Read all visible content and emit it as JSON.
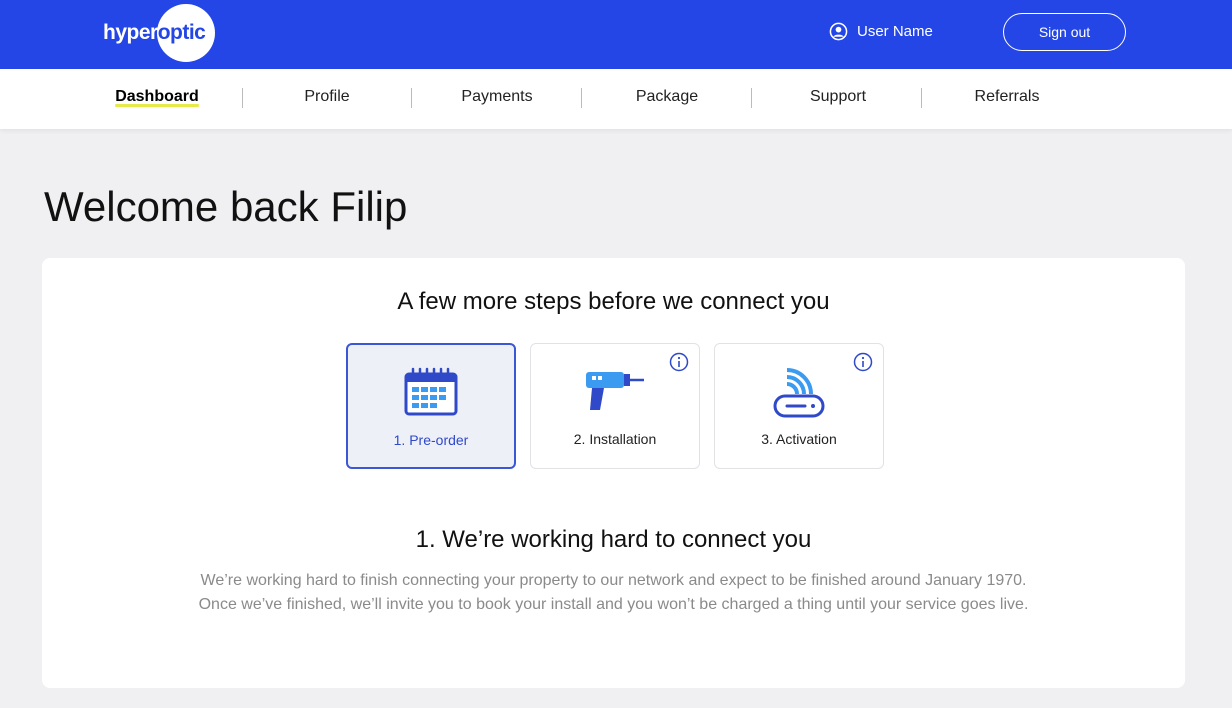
{
  "header": {
    "logo_prefix": "hyper",
    "logo_highlight": "optic",
    "user_name": "User Name",
    "sign_out_label": "Sign out",
    "brand_color": "#2446e6"
  },
  "nav": {
    "items": [
      {
        "label": "Dashboard",
        "active": true
      },
      {
        "label": "Profile"
      },
      {
        "label": "Payments"
      },
      {
        "label": "Package"
      },
      {
        "label": "Support"
      },
      {
        "label": "Referrals"
      }
    ]
  },
  "main": {
    "welcome": "Welcome back Filip",
    "card": {
      "title": "A few more steps before we connect you",
      "steps": [
        {
          "label": "1. Pre-order",
          "icon": "calendar-icon",
          "active": true
        },
        {
          "label": "2. Installation",
          "icon": "drill-icon"
        },
        {
          "label": "3. Activation",
          "icon": "router-icon"
        }
      ],
      "status_title": "1. We’re working hard to connect you",
      "status_line1": "We’re working hard to finish connecting your property to our network and expect to be finished around January 1970.",
      "status_line2": "Once we’ve finished, we’ll invite you to book your install and you won’t be charged a thing until your service goes live."
    }
  }
}
